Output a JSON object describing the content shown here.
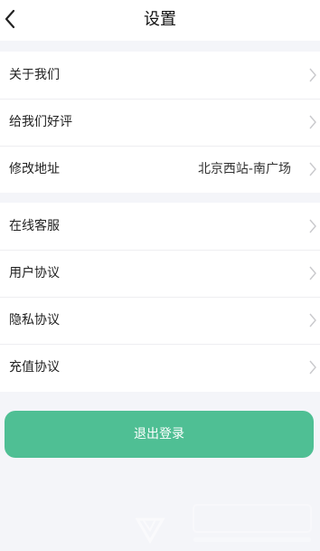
{
  "header": {
    "title": "设置",
    "back_icon": "chevron-left-icon"
  },
  "group1": [
    {
      "label": "关于我们",
      "value": ""
    },
    {
      "label": "给我们好评",
      "value": ""
    },
    {
      "label": "修改地址",
      "value": "北京西站-南广场"
    }
  ],
  "group2": [
    {
      "label": "在线客服",
      "value": ""
    },
    {
      "label": "用户协议",
      "value": ""
    },
    {
      "label": "隐私协议",
      "value": ""
    },
    {
      "label": "充值协议",
      "value": ""
    }
  ],
  "actions": {
    "logout_label": "退出登录"
  },
  "colors": {
    "accent": "#4fbf94",
    "background": "#f4f5f9",
    "chevron": "#c9c9cc"
  }
}
